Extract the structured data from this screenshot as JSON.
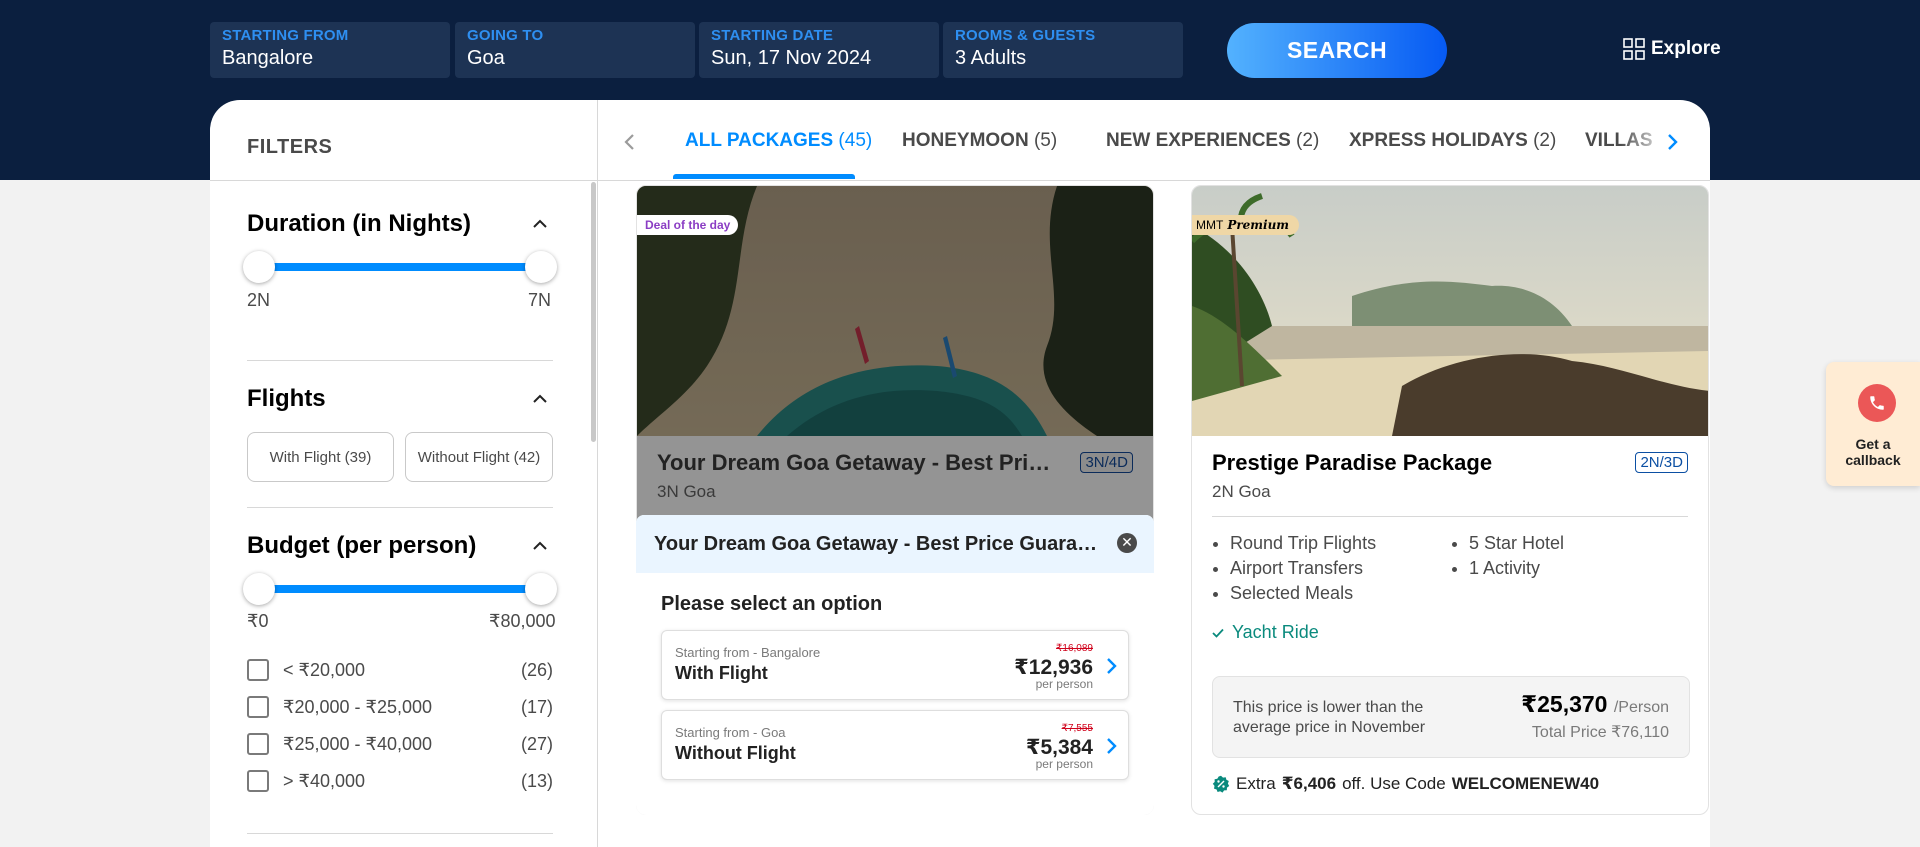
{
  "search": {
    "fields": [
      {
        "label": "STARTING FROM",
        "value": "Bangalore"
      },
      {
        "label": "GOING TO",
        "value": "Goa"
      },
      {
        "label": "STARTING DATE",
        "value": "Sun, 17 Nov 2024"
      },
      {
        "label": "ROOMS & GUESTS",
        "value": "3 Adults"
      }
    ],
    "button_label": "SEARCH",
    "explore_label": "Explore"
  },
  "filters": {
    "title": "FILTERS",
    "duration": {
      "title": "Duration (in Nights)",
      "min_label": "2N",
      "max_label": "7N"
    },
    "flights": {
      "title": "Flights",
      "options": [
        "With Flight (39)",
        "Without Flight (42)"
      ]
    },
    "budget": {
      "title": "Budget (per person)",
      "min_label": "₹0",
      "max_label": "₹80,000",
      "ranges": [
        {
          "label": "< ₹20,000",
          "count": "(26)"
        },
        {
          "label": "₹20,000 - ₹25,000",
          "count": "(17)"
        },
        {
          "label": "₹25,000 - ₹40,000",
          "count": "(27)"
        },
        {
          "label": "> ₹40,000",
          "count": "(13)"
        }
      ]
    }
  },
  "tabs": [
    {
      "label": "ALL PACKAGES",
      "count": "(45)",
      "active": true
    },
    {
      "label": "HONEYMOON",
      "count": "(5)"
    },
    {
      "label": "NEW EXPERIENCES",
      "count": "(2)"
    },
    {
      "label": "XPRESS HOLIDAYS",
      "count": "(2)"
    },
    {
      "label": "VILLAS",
      "count": ""
    }
  ],
  "cards": [
    {
      "badge": "Deal of the day",
      "title": "Your Dream Goa Getaway - Best Price ...",
      "duration": "3N/4D",
      "subtitle": "3N Goa",
      "popup": {
        "title": "Your Dream Goa Getaway - Best Price Guarante...",
        "close": "✕",
        "heading": "Please select an option",
        "options": [
          {
            "from": "Starting from - Bangalore",
            "type": "With Flight",
            "old_price": "₹16,089",
            "price": "₹12,936",
            "per": "per person"
          },
          {
            "from": "Starting from - Goa",
            "type": "Without Flight",
            "old_price": "₹7,555",
            "price": "₹5,384",
            "per": "per person"
          }
        ]
      }
    },
    {
      "badge_prefix": "MMT",
      "badge_label": "Premium",
      "title": "Prestige Paradise Package",
      "duration": "2N/3D",
      "subtitle": "2N Goa",
      "features_left": [
        "Round Trip Flights",
        "Airport Transfers",
        "Selected Meals"
      ],
      "features_right": [
        "5 Star Hotel",
        "1 Activity"
      ],
      "highlight": "Yacht Ride",
      "price_note": "This price is lower than the average price in November",
      "price": "₹25,370",
      "price_unit": "/Person",
      "total": "Total Price ₹76,110",
      "offer_prefix": "Extra",
      "offer_amount": "₹6,406",
      "offer_mid": "off. Use Code",
      "offer_code": "WELCOMENEW40"
    }
  ],
  "callback": {
    "line1": "Get a",
    "line2": "callback"
  },
  "colors": {
    "header_bg": "#0b1f3f",
    "accent": "#008cff",
    "search_gradient_start": "#53b2fe",
    "search_gradient_end": "#065af3",
    "teal": "#0a8a7d"
  }
}
